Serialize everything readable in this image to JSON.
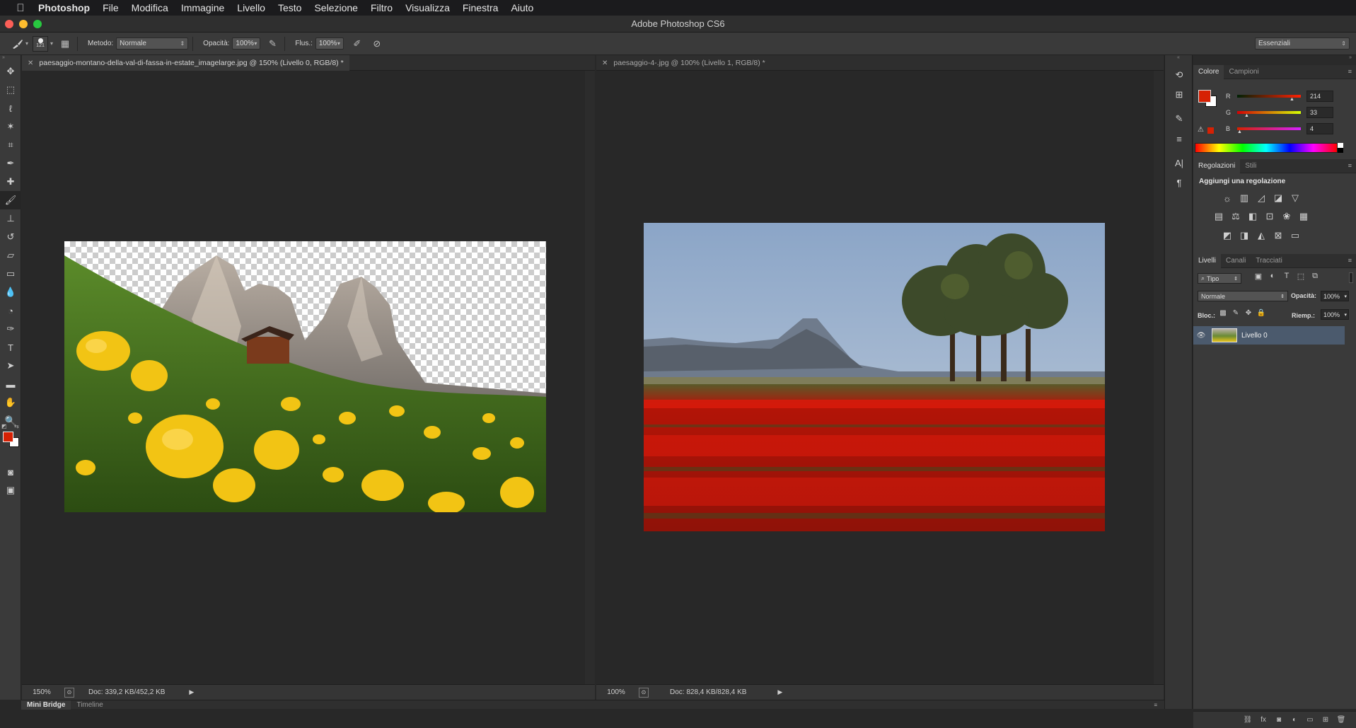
{
  "menubar": {
    "app_name": "Photoshop",
    "items": [
      "File",
      "Modifica",
      "Immagine",
      "Livello",
      "Testo",
      "Selezione",
      "Filtro",
      "Visualizza",
      "Finestra",
      "Aiuto"
    ]
  },
  "window": {
    "title": "Adobe Photoshop CS6"
  },
  "options_bar": {
    "brush_size": "121",
    "mode_label": "Metodo:",
    "mode_value": "Normale",
    "opacity_label": "Opacità:",
    "opacity_value": "100%",
    "flow_label": "Flus.:",
    "flow_value": "100%",
    "workspace_value": "Essenziali"
  },
  "toolbar": {
    "icons": [
      "move-icon",
      "marquee-icon",
      "lasso-icon",
      "magic-wand-icon",
      "crop-icon",
      "eyedropper-icon",
      "spot-healing-icon",
      "brush-icon",
      "clone-stamp-icon",
      "history-brush-icon",
      "eraser-icon",
      "gradient-icon",
      "blur-icon",
      "dodge-icon",
      "pen-icon",
      "type-icon",
      "path-selection-icon",
      "rectangle-icon",
      "hand-icon",
      "zoom-icon"
    ],
    "foreground_color": "#d62104",
    "background_color": "#ffffff"
  },
  "documents": [
    {
      "tab_title": "paesaggio-montano-della-val-di-fassa-in-estate_imagelarge.jpg @ 150% (Livello 0, RGB/8) *",
      "zoom": "150%",
      "doc_info": "Doc: 339,2 KB/452,2 KB",
      "active": true
    },
    {
      "tab_title": "paesaggio-4-.jpg @ 100% (Livello 1, RGB/8) *",
      "zoom": "100%",
      "doc_info": "Doc: 828,4 KB/828,4 KB",
      "active": false
    }
  ],
  "color_panel": {
    "tabs": [
      "Colore",
      "Campioni"
    ],
    "channels": [
      {
        "label": "R",
        "value": "214"
      },
      {
        "label": "G",
        "value": "33"
      },
      {
        "label": "B",
        "value": "4"
      }
    ],
    "swatch": "#d62104"
  },
  "adjustments_panel": {
    "tabs": [
      "Regolazioni",
      "Stili"
    ],
    "heading": "Aggiungi una regolazione"
  },
  "layers_panel": {
    "tabs": [
      "Livelli",
      "Canali",
      "Tracciati"
    ],
    "filter_label": "Tipo",
    "blend_mode": "Normale",
    "opacity_label": "Opacità:",
    "opacity_value": "100%",
    "lock_label": "Bloc.:",
    "fill_label": "Riemp.:",
    "fill_value": "100%",
    "layers": [
      {
        "name": "Livello 0",
        "visible": true
      }
    ]
  },
  "bottom_tabs": [
    "Mini Bridge",
    "Timeline"
  ]
}
